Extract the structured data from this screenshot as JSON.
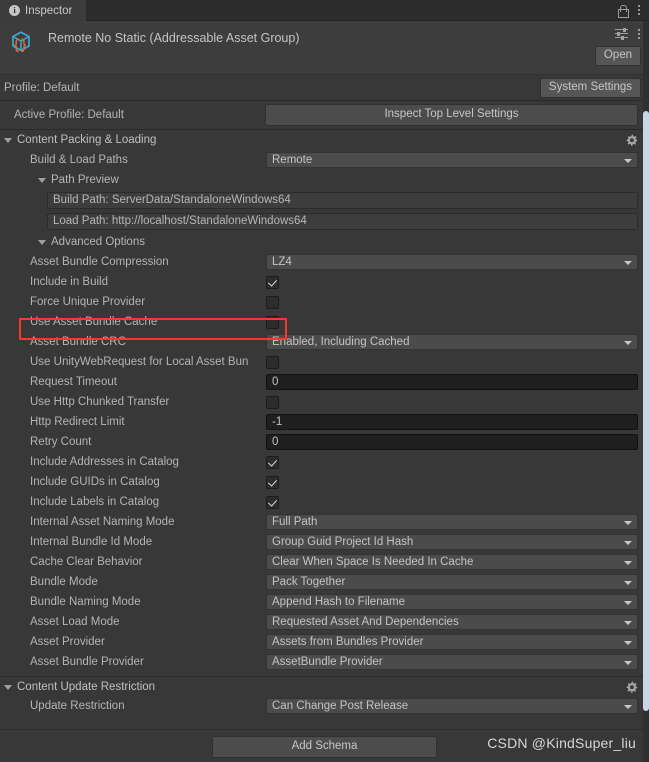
{
  "window": {
    "tab_label": "Inspector",
    "tab_icon": "info-icon",
    "lock_icon": "lock-icon",
    "menu_icon": "kebab-menu-icon"
  },
  "object_header": {
    "icon": "addressable-asset-group-icon",
    "title": "Remote No Static (Addressable Asset Group)",
    "preset_icon": "sliders-icon",
    "menu_icon": "kebab-menu-icon",
    "open_button": "Open"
  },
  "profile_bar": {
    "label": "Profile: Default",
    "system_settings_button": "System Settings"
  },
  "active_profile": {
    "label": "Active Profile: Default",
    "button": "Inspect Top Level Settings"
  },
  "content_packing": {
    "title": "Content Packing & Loading",
    "gear_icon": "gear-icon",
    "build_load_paths": {
      "label": "Build & Load Paths",
      "value": "Remote"
    },
    "path_preview": {
      "title": "Path Preview",
      "build_path": "Build Path: ServerData/StandaloneWindows64",
      "load_path": "Load Path: http://localhost/StandaloneWindows64"
    },
    "advanced_options": {
      "title": "Advanced Options",
      "rows": [
        {
          "label": "Asset Bundle Compression",
          "type": "dropdown",
          "value": "LZ4"
        },
        {
          "label": "Include in Build",
          "type": "checkbox",
          "checked": true
        },
        {
          "label": "Force Unique Provider",
          "type": "checkbox",
          "checked": false
        },
        {
          "label": "Use Asset Bundle Cache",
          "type": "checkbox",
          "checked": false,
          "highlighted": true
        },
        {
          "label": "Asset Bundle CRC",
          "type": "dropdown",
          "value": "Enabled, Including Cached"
        },
        {
          "label": "Use UnityWebRequest for Local Asset Bun",
          "type": "checkbox",
          "checked": false
        },
        {
          "label": "Request Timeout",
          "type": "textfield",
          "value": "0"
        },
        {
          "label": "Use Http Chunked Transfer",
          "type": "checkbox",
          "checked": false
        },
        {
          "label": "Http Redirect Limit",
          "type": "textfield",
          "value": "-1"
        },
        {
          "label": "Retry Count",
          "type": "textfield",
          "value": "0"
        },
        {
          "label": "Include Addresses in Catalog",
          "type": "checkbox",
          "checked": true
        },
        {
          "label": "Include GUIDs in Catalog",
          "type": "checkbox",
          "checked": true
        },
        {
          "label": "Include Labels in Catalog",
          "type": "checkbox",
          "checked": true
        },
        {
          "label": "Internal Asset Naming Mode",
          "type": "dropdown",
          "value": "Full Path"
        },
        {
          "label": "Internal Bundle Id Mode",
          "type": "dropdown",
          "value": "Group Guid Project Id Hash"
        },
        {
          "label": "Cache Clear Behavior",
          "type": "dropdown",
          "value": "Clear When Space Is Needed In Cache"
        },
        {
          "label": "Bundle Mode",
          "type": "dropdown",
          "value": "Pack Together"
        },
        {
          "label": "Bundle Naming Mode",
          "type": "dropdown",
          "value": "Append Hash to Filename"
        },
        {
          "label": "Asset Load Mode",
          "type": "dropdown",
          "value": "Requested Asset And Dependencies"
        },
        {
          "label": "Asset Provider",
          "type": "dropdown",
          "value": "Assets from Bundles Provider"
        },
        {
          "label": "Asset Bundle Provider",
          "type": "dropdown",
          "value": "AssetBundle Provider"
        }
      ]
    }
  },
  "content_update_restriction": {
    "title": "Content Update Restriction",
    "gear_icon": "gear-icon",
    "update_restriction": {
      "label": "Update Restriction",
      "value": "Can Change Post Release"
    }
  },
  "footer": {
    "add_schema_button": "Add Schema",
    "watermark": "CSDN @KindSuper_liu"
  },
  "colors": {
    "highlight": "#f03c2e",
    "panel_bg": "#383838",
    "icon_cyan": "#3fa9c9",
    "icon_orange": "#e8643c",
    "scrollbar": "#c8d7e8"
  }
}
